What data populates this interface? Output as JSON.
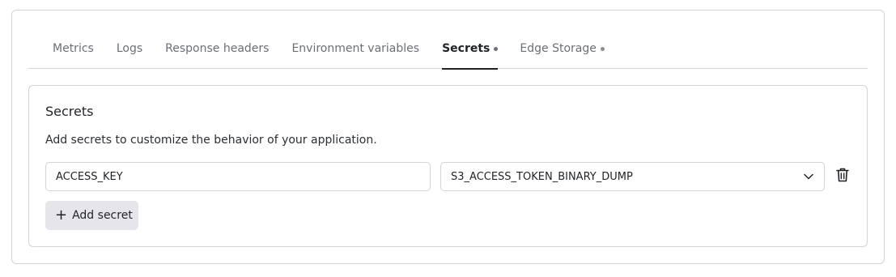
{
  "tabs": [
    {
      "label": "Metrics",
      "active": false,
      "dot": false
    },
    {
      "label": "Logs",
      "active": false,
      "dot": false
    },
    {
      "label": "Response headers",
      "active": false,
      "dot": false
    },
    {
      "label": "Environment variables",
      "active": false,
      "dot": false
    },
    {
      "label": "Secrets",
      "active": true,
      "dot": true
    },
    {
      "label": "Edge Storage",
      "active": false,
      "dot": true
    }
  ],
  "secrets": {
    "title": "Secrets",
    "description": "Add secrets to customize the behavior of your application.",
    "rows": [
      {
        "key": "ACCESS_KEY",
        "value": "S3_ACCESS_TOKEN_BINARY_DUMP"
      }
    ],
    "add_label": "Add secret",
    "add_icon": "+"
  },
  "icons": {
    "select": "chevron-down-icon",
    "delete": "trash-icon"
  },
  "colors": {
    "border": "#d4d4d8",
    "active_tab": "#1f2328",
    "inactive_tab": "#6b6f76",
    "button_bg": "#e6e6ea"
  }
}
